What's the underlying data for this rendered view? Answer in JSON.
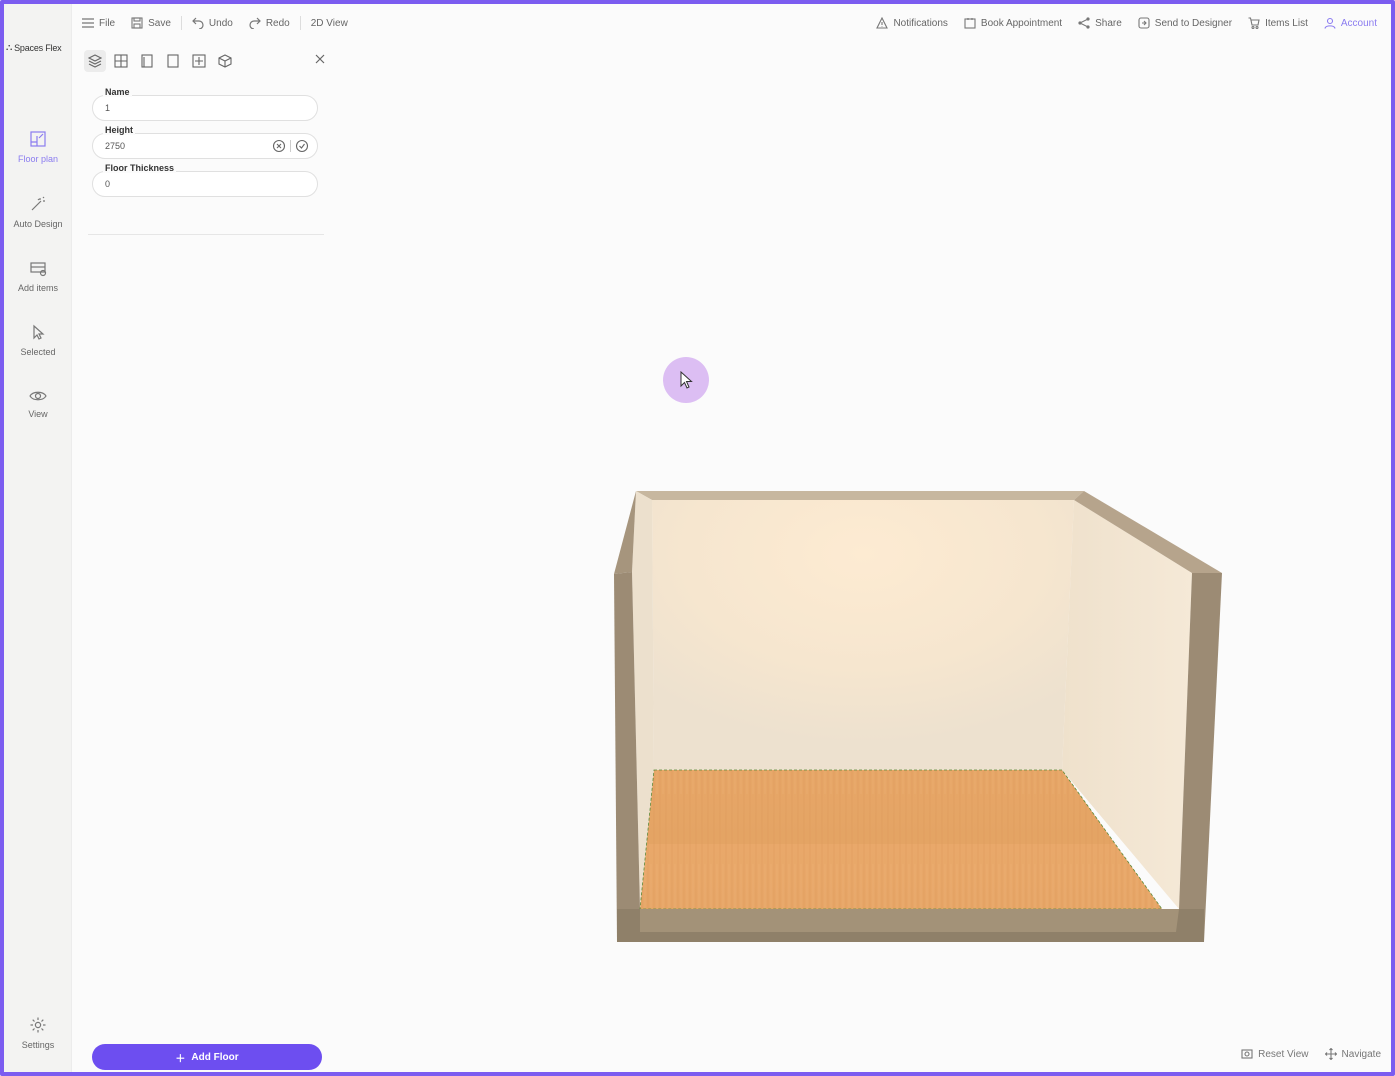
{
  "brand": {
    "name": "Spaces Flex"
  },
  "rail": {
    "items": [
      {
        "label": "Floor plan",
        "icon": "floor-plan-icon",
        "active": true
      },
      {
        "label": "Auto Design",
        "icon": "magic-wand-icon"
      },
      {
        "label": "Add items",
        "icon": "add-items-icon"
      },
      {
        "label": "Selected",
        "icon": "pointer-icon"
      },
      {
        "label": "View",
        "icon": "eye-icon"
      }
    ],
    "settings": {
      "label": "Settings",
      "icon": "gear-icon"
    }
  },
  "toolbar": {
    "file": "File",
    "save": "Save",
    "undo": "Undo",
    "redo": "Redo",
    "view": "2D View",
    "notifications": "Notifications",
    "book": "Book Appointment",
    "share": "Share",
    "send": "Send to Designer",
    "items": "Items List",
    "account": "Account"
  },
  "panel": {
    "fields": [
      {
        "label": "Name",
        "value": "1"
      },
      {
        "label": "Height",
        "value": "2750"
      },
      {
        "label": "Floor Thickness",
        "value": "0"
      }
    ]
  },
  "actions": {
    "add_floor": "Add Floor"
  },
  "bottom": {
    "reset": "Reset View",
    "navigate": "Navigate"
  },
  "colors": {
    "accent": "#6d4ef0",
    "frame": "#7b5cf0",
    "wall": "#f7e6cc",
    "wall_edge": "#9c8b74",
    "floor": "#e9a86a"
  }
}
